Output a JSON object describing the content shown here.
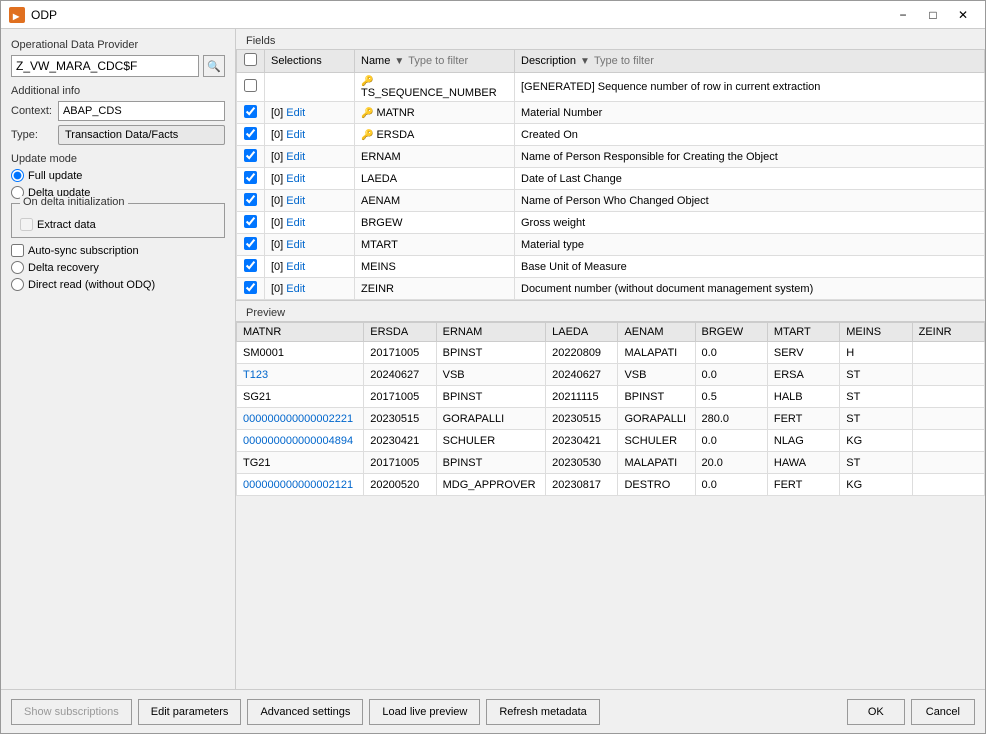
{
  "window": {
    "title": "ODP",
    "icon": "ODP"
  },
  "left_panel": {
    "odp_label": "Operational Data Provider",
    "odp_value": "Z_VW_MARA_CDC$F",
    "additional_info_label": "Additional info",
    "context_label": "Context:",
    "context_value": "ABAP_CDS",
    "type_label": "Type:",
    "type_value": "Transaction Data/Facts",
    "update_mode_label": "Update mode",
    "full_update_label": "Full update",
    "delta_update_label": "Delta update",
    "on_delta_init_label": "On delta initialization",
    "extract_data_label": "Extract data",
    "auto_sync_label": "Auto-sync subscription",
    "delta_recovery_label": "Delta recovery",
    "direct_read_label": "Direct read (without ODQ)"
  },
  "fields": {
    "section_label": "Fields",
    "col_check": "",
    "col_selections": "Selections",
    "col_name": "Name",
    "col_desc": "Description",
    "name_filter_placeholder": "Type to filter",
    "desc_filter_placeholder": "Type to filter",
    "rows": [
      {
        "checked": false,
        "selections": "",
        "key": true,
        "name": "TS_SEQUENCE_NUMBER",
        "desc": "[GENERATED] Sequence number of row in current extraction"
      },
      {
        "checked": true,
        "selections": "[0]",
        "key": true,
        "name": "MATNR",
        "desc": "Material Number"
      },
      {
        "checked": true,
        "selections": "[0]",
        "key": true,
        "name": "ERSDA",
        "desc": "Created On"
      },
      {
        "checked": true,
        "selections": "[0]",
        "key": false,
        "name": "ERNAM",
        "desc": "Name of Person Responsible for Creating the Object"
      },
      {
        "checked": true,
        "selections": "[0]",
        "key": false,
        "name": "LAEDA",
        "desc": "Date of Last Change"
      },
      {
        "checked": true,
        "selections": "[0]",
        "key": false,
        "name": "AENAM",
        "desc": "Name of Person Who Changed Object"
      },
      {
        "checked": true,
        "selections": "[0]",
        "key": false,
        "name": "BRGEW",
        "desc": "Gross weight"
      },
      {
        "checked": true,
        "selections": "[0]",
        "key": false,
        "name": "MTART",
        "desc": "Material type"
      },
      {
        "checked": true,
        "selections": "[0]",
        "key": false,
        "name": "MEINS",
        "desc": "Base Unit of Measure"
      },
      {
        "checked": true,
        "selections": "[0]",
        "key": false,
        "name": "ZEINR",
        "desc": "Document number (without document management system)"
      }
    ]
  },
  "preview": {
    "section_label": "Preview",
    "columns": [
      "MATNR",
      "ERSDA",
      "ERNAM",
      "LAEDA",
      "AENAM",
      "BRGEW",
      "MTART",
      "MEINS",
      "ZEINR"
    ],
    "rows": [
      {
        "MATNR": "SM0001",
        "ERSDA": "20171005",
        "ERNAM": "BPINST",
        "LAEDA": "20220809",
        "AENAM": "MALAPATI",
        "BRGEW": "0.0",
        "MTART": "SERV",
        "MEINS": "H",
        "ZEINR": "",
        "link": false
      },
      {
        "MATNR": "T123",
        "ERSDA": "20240627",
        "ERNAM": "VSB",
        "LAEDA": "20240627",
        "AENAM": "VSB",
        "BRGEW": "0.0",
        "MTART": "ERSA",
        "MEINS": "ST",
        "ZEINR": "",
        "link": true
      },
      {
        "MATNR": "SG21",
        "ERSDA": "20171005",
        "ERNAM": "BPINST",
        "LAEDA": "20211115",
        "AENAM": "BPINST",
        "BRGEW": "0.5",
        "MTART": "HALB",
        "MEINS": "ST",
        "ZEINR": "",
        "link": false
      },
      {
        "MATNR": "000000000000002221",
        "ERSDA": "20230515",
        "ERNAM": "GORAPALLI",
        "LAEDA": "20230515",
        "AENAM": "GORAPALLI",
        "BRGEW": "280.0",
        "MTART": "FERT",
        "MEINS": "ST",
        "ZEINR": "",
        "link": true
      },
      {
        "MATNR": "000000000000004894",
        "ERSDA": "20230421",
        "ERNAM": "SCHULER",
        "LAEDA": "20230421",
        "AENAM": "SCHULER",
        "BRGEW": "0.0",
        "MTART": "NLAG",
        "MEINS": "KG",
        "ZEINR": "",
        "link": true
      },
      {
        "MATNR": "TG21",
        "ERSDA": "20171005",
        "ERNAM": "BPINST",
        "LAEDA": "20230530",
        "AENAM": "MALAPATI",
        "BRGEW": "20.0",
        "MTART": "HAWA",
        "MEINS": "ST",
        "ZEINR": "",
        "link": false
      },
      {
        "MATNR": "000000000000002121",
        "ERSDA": "20200520",
        "ERNAM": "MDG_APPROVER",
        "LAEDA": "20230817",
        "AENAM": "DESTRO",
        "BRGEW": "0.0",
        "MTART": "FERT",
        "MEINS": "KG",
        "ZEINR": "",
        "link": true
      }
    ]
  },
  "bottom_bar": {
    "show_subscriptions_label": "Show subscriptions",
    "edit_parameters_label": "Edit parameters",
    "advanced_settings_label": "Advanced settings",
    "load_preview_label": "Load live preview",
    "refresh_metadata_label": "Refresh metadata",
    "ok_label": "OK",
    "cancel_label": "Cancel"
  }
}
